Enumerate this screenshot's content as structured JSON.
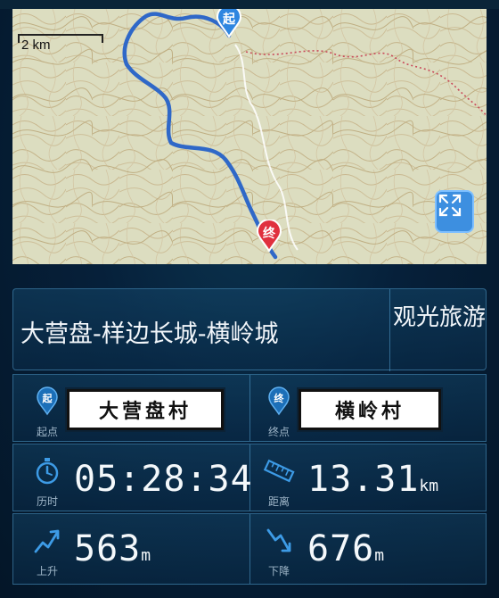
{
  "map": {
    "scale_label": "2 km",
    "start_marker": "起",
    "end_marker": "终",
    "colors": {
      "route": "#2f68c8",
      "start": "#2f86e0",
      "end": "#e0303e",
      "expand_button": "#3d8fe0"
    }
  },
  "route": {
    "title": "大营盘-样边长城-横岭城",
    "category": "观光旅游"
  },
  "start": {
    "label": "起点",
    "name": "大营盘村",
    "icon": "start-pin-icon"
  },
  "end": {
    "label": "终点",
    "name": "横岭村",
    "icon": "end-pin-icon"
  },
  "duration": {
    "label": "历时",
    "value": "05:28:34",
    "icon": "stopwatch-icon"
  },
  "distance": {
    "label": "距离",
    "value": "13.31",
    "unit": "km",
    "icon": "ruler-icon"
  },
  "ascent": {
    "label": "上升",
    "value": "563",
    "unit": "m",
    "icon": "ascent-arrow-icon"
  },
  "descent": {
    "label": "下降",
    "value": "676",
    "unit": "m",
    "icon": "descent-arrow-icon"
  }
}
